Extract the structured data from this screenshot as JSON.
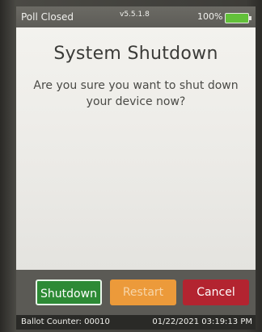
{
  "status_bar": {
    "poll_status": "Poll Closed",
    "version": "v5.5.1.8",
    "battery_percent": "100%",
    "battery_icon": "battery-full-icon",
    "battery_color": "#62c13a"
  },
  "dialog": {
    "title": "System Shutdown",
    "message": "Are you sure you want to shut down your device now?"
  },
  "buttons": {
    "shutdown_label": "Shutdown",
    "restart_label": "Restart",
    "cancel_label": "Cancel",
    "shutdown_color": "#2d8a35",
    "restart_color": "#ec9a3a",
    "cancel_color": "#b32430"
  },
  "footer": {
    "ballot_counter": "Ballot Counter: 00010",
    "datetime": "01/22/2021 03:19:13 PM"
  }
}
